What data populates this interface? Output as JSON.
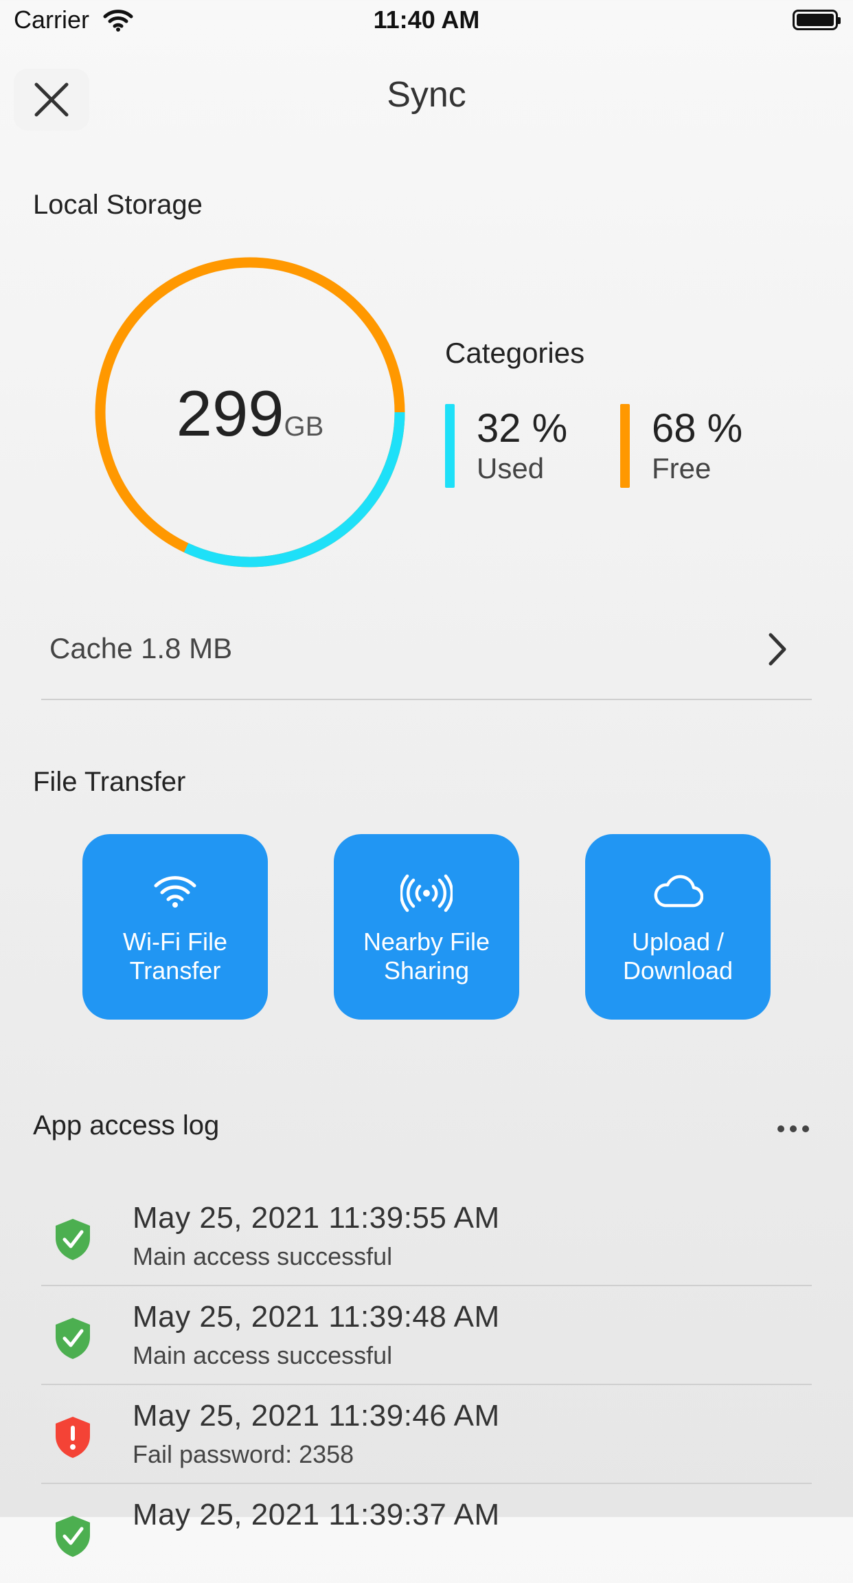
{
  "status_bar": {
    "carrier": "Carrier",
    "time": "11:40 AM"
  },
  "nav": {
    "title": "Sync",
    "close_icon": "close-icon"
  },
  "local_storage": {
    "title": "Local Storage",
    "total_value": "299",
    "total_unit": "GB",
    "categories_title": "Categories",
    "categories": [
      {
        "percent_label": "32 %",
        "label": "Used",
        "fraction": 0.32,
        "color": "#1ee0f8"
      },
      {
        "percent_label": "68 %",
        "label": "Free",
        "fraction": 0.68,
        "color": "#ff9800"
      }
    ],
    "cache_label": "Cache 1.8 MB"
  },
  "file_transfer": {
    "title": "File Transfer",
    "tiles": [
      {
        "label_line1": "Wi-Fi File",
        "label_line2": "Transfer",
        "icon": "wifi-icon"
      },
      {
        "label_line1": "Nearby File",
        "label_line2": "Sharing",
        "icon": "broadcast-icon"
      },
      {
        "label_line1": "Upload /",
        "label_line2": "Download",
        "icon": "cloud-icon"
      }
    ],
    "tile_color": "#2196f3"
  },
  "access_log": {
    "title": "App access log",
    "entries": [
      {
        "timestamp": "May 25, 2021 11:39:55 AM",
        "message": "Main access successful",
        "status": "success"
      },
      {
        "timestamp": "May 25, 2021 11:39:48 AM",
        "message": "Main access successful",
        "status": "success"
      },
      {
        "timestamp": "May 25, 2021 11:39:46 AM",
        "message": "Fail password: 2358",
        "status": "fail"
      },
      {
        "timestamp": "May 25, 2021 11:39:37 AM",
        "message": "",
        "status": "success"
      }
    ],
    "success_color": "#4caf50",
    "fail_color": "#f44336"
  }
}
